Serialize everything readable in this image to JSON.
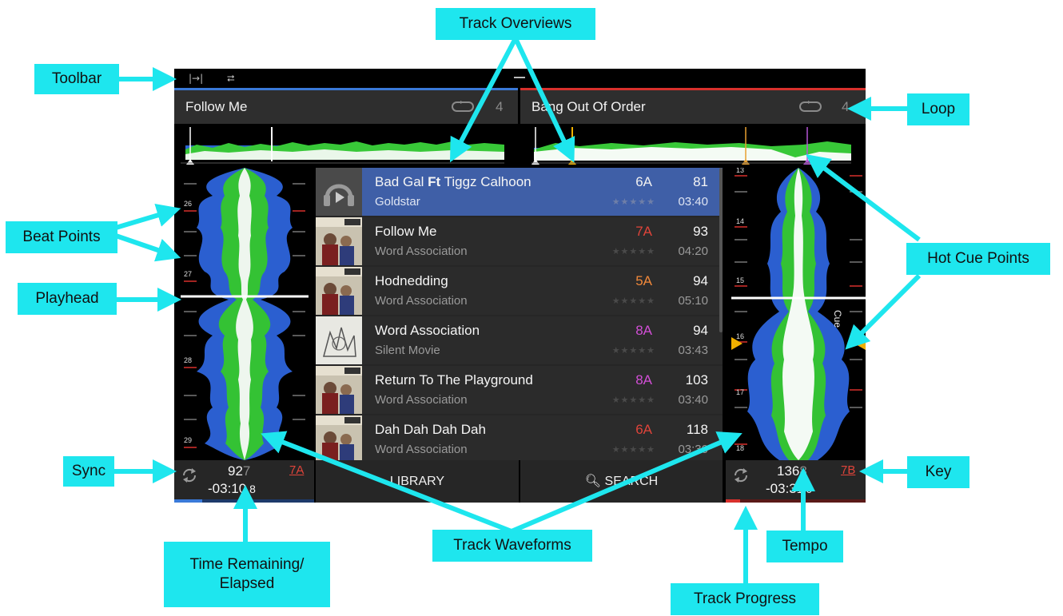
{
  "colors": {
    "deck1": "#3a79d8",
    "deck2": "#d8302c",
    "callout": "#1ee6ee",
    "selected_row": "#3f5fa7"
  },
  "deck1": {
    "title": "Follow Me",
    "loop_count": "4",
    "beat_markers": [
      "26",
      "27",
      "28",
      "29"
    ],
    "bpm_main": "92",
    "bpm_dim": "7",
    "key": "7A",
    "time_main": "-03:10",
    "time_frac": ".8",
    "progress": 0.2
  },
  "deck2": {
    "title": "Bang Out Of Order",
    "loop_count": "4",
    "beat_markers": [
      "13",
      "14",
      "15",
      "16",
      "17",
      "18"
    ],
    "cue_label": "Cue",
    "bpm_main": "136",
    "bpm_dim": "8",
    "key": "7B",
    "time_main": "-03:3",
    "time_frac": "1.0",
    "progress": 0.1
  },
  "toolbar": {
    "icons": [
      "tempo-range-icon",
      "repeat-icon"
    ]
  },
  "library": {
    "tracks": [
      {
        "title_a": "Bad Gal ",
        "title_b": "Ft",
        "title_c": " Tiggz Calhoon",
        "artist": "Goldstar",
        "key": "6A",
        "key_color": "#f0f0f0",
        "bpm": "81",
        "time": "03:40",
        "stars": "★★★★★"
      },
      {
        "title_a": "Follow Me",
        "title_b": "",
        "title_c": "",
        "artist": "Word Association",
        "key": "7A",
        "key_color": "#e0443a",
        "bpm": "93",
        "time": "04:20",
        "stars": "★★★★★"
      },
      {
        "title_a": "Hodnedding",
        "title_b": "",
        "title_c": "",
        "artist": "Word Association",
        "key": "5A",
        "key_color": "#f0883a",
        "bpm": "94",
        "time": "05:10",
        "stars": "★★★★★"
      },
      {
        "title_a": "Word Association",
        "title_b": "",
        "title_c": "",
        "artist": "Silent Movie",
        "key": "8A",
        "key_color": "#d24fd6",
        "bpm": "94",
        "time": "03:43",
        "stars": "★★★★★"
      },
      {
        "title_a": "Return To The Playground",
        "title_b": "",
        "title_c": "",
        "artist": "Word Association",
        "key": "8A",
        "key_color": "#d24fd6",
        "bpm": "103",
        "time": "03:40",
        "stars": "★★★★★"
      },
      {
        "title_a": "Dah Dah Dah Dah",
        "title_b": "",
        "title_c": "",
        "artist": "Word Association",
        "key": "6A",
        "key_color": "#e0443a",
        "bpm": "118",
        "time": "03:30",
        "stars": "★★★★★"
      }
    ],
    "library_label": "LIBRARY",
    "search_label": "SEARCH"
  },
  "callouts": {
    "toolbar": "Toolbar",
    "track_overviews": "Track Overviews",
    "loop": "Loop",
    "beat_points": "Beat Points",
    "hot_cue_points": "Hot Cue Points",
    "playhead": "Playhead",
    "sync": "Sync",
    "key": "Key",
    "time_remaining_1": "Time Remaining/",
    "time_remaining_2": "Elapsed",
    "track_waveforms": "Track Waveforms",
    "tempo": "Tempo",
    "track_progress": "Track Progress"
  }
}
